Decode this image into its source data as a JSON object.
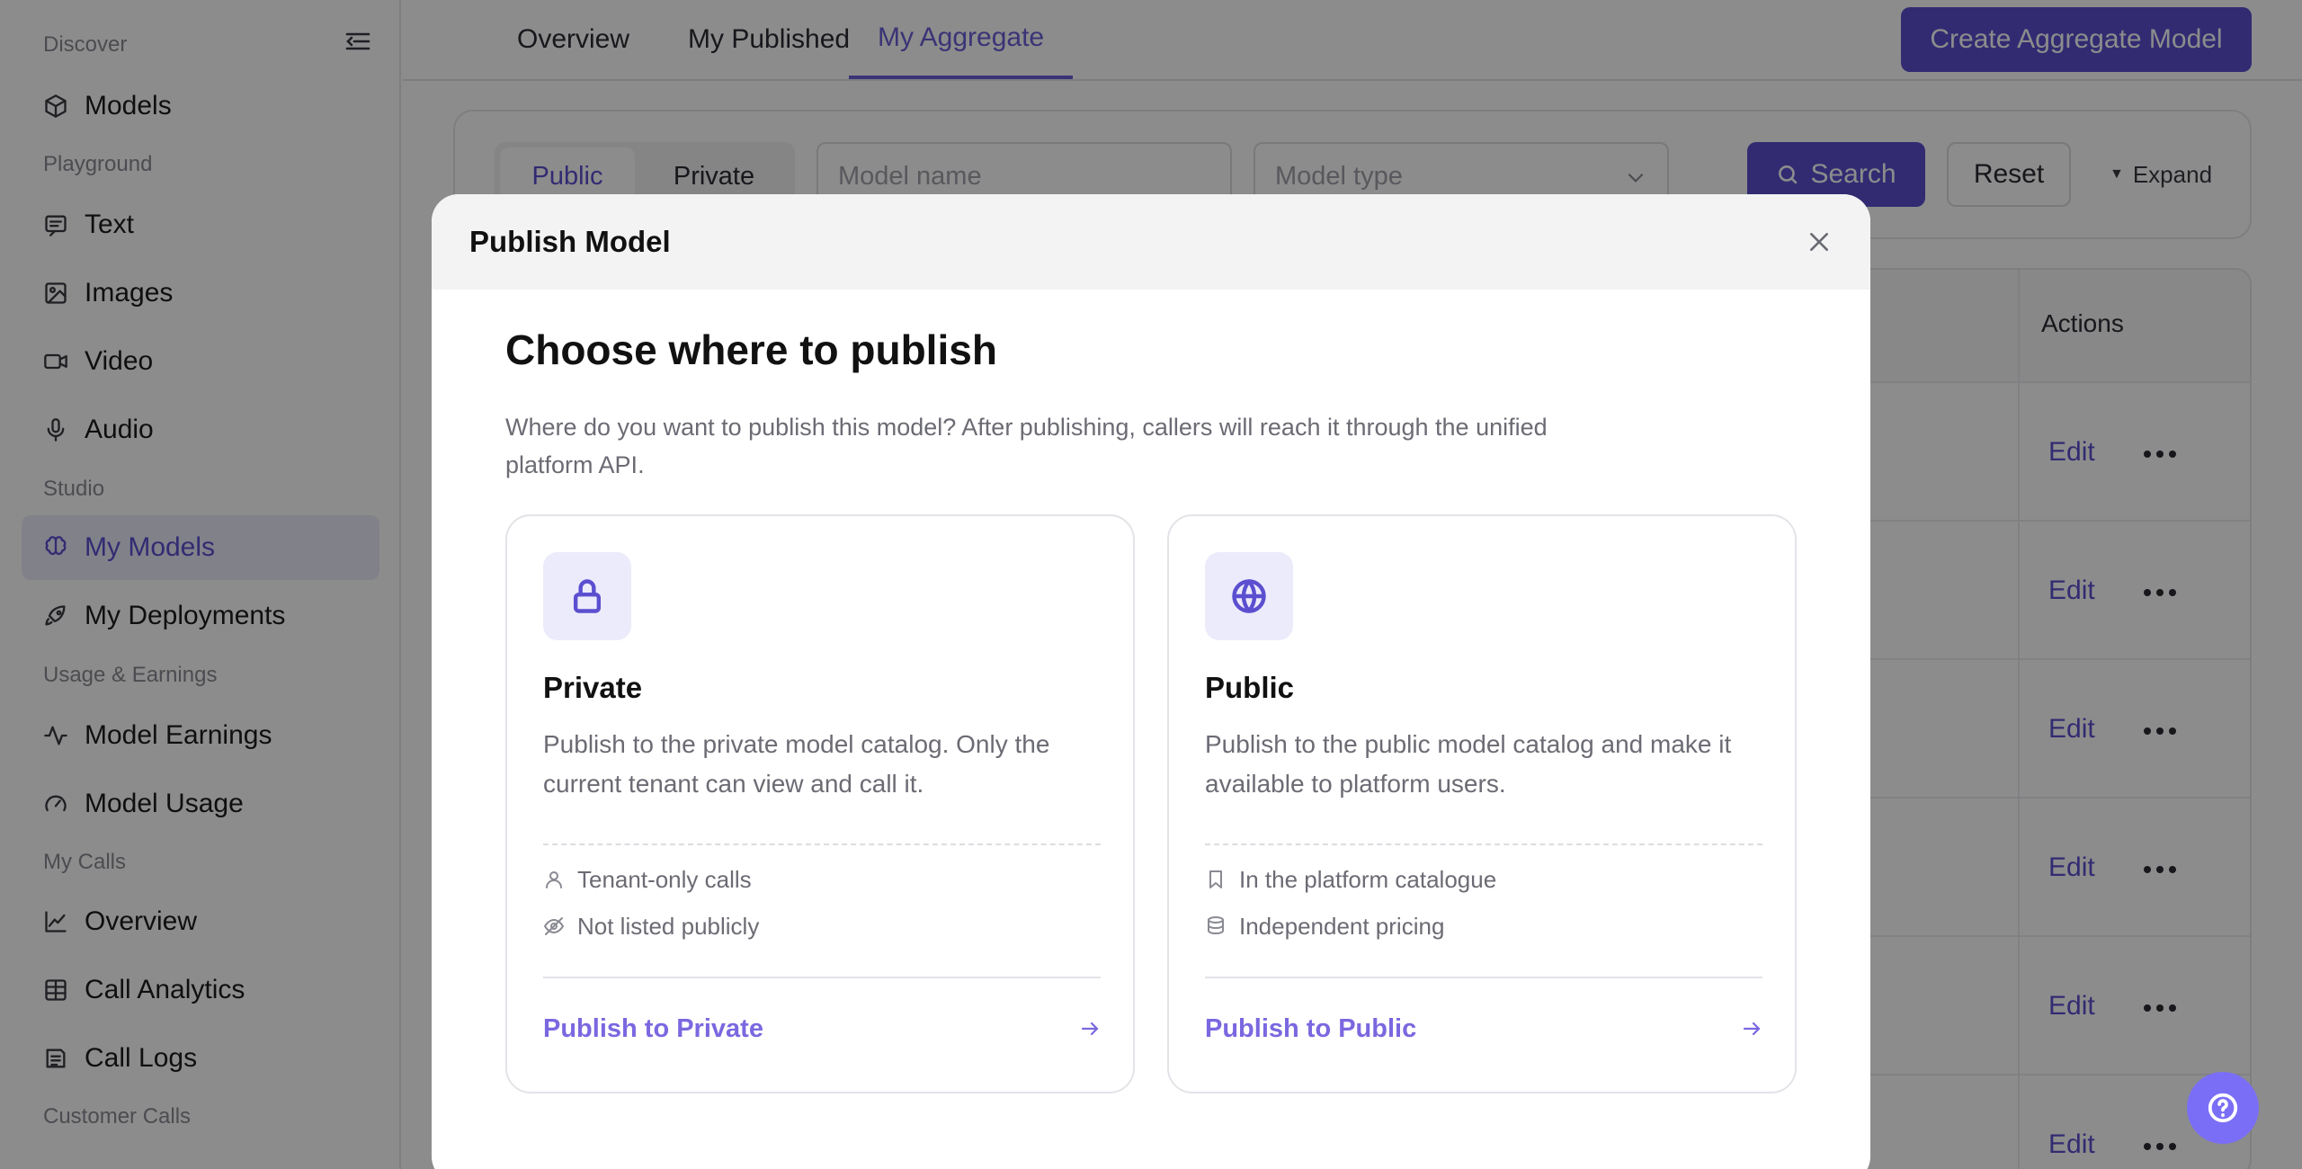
{
  "sidebar": {
    "sections": {
      "discover": "Discover",
      "playground": "Playground",
      "studio": "Studio",
      "usage": "Usage & Earnings",
      "calls": "My Calls",
      "customer": "Customer Calls"
    },
    "items": [
      {
        "label": "Models",
        "icon": "cube-icon"
      },
      {
        "label": "Text",
        "icon": "message-icon"
      },
      {
        "label": "Images",
        "icon": "image-icon"
      },
      {
        "label": "Video",
        "icon": "video-icon"
      },
      {
        "label": "Audio",
        "icon": "microphone-icon"
      },
      {
        "label": "My Models",
        "icon": "brain-icon",
        "active": true
      },
      {
        "label": "My Deployments",
        "icon": "rocket-icon"
      },
      {
        "label": "Model Earnings",
        "icon": "activity-icon"
      },
      {
        "label": "Model Usage",
        "icon": "gauge-icon"
      },
      {
        "label": "Overview",
        "icon": "line-chart-icon"
      },
      {
        "label": "Call Analytics",
        "icon": "table-icon"
      },
      {
        "label": "Call Logs",
        "icon": "log-icon"
      }
    ]
  },
  "topbar": {
    "tabs": [
      {
        "label": "Overview"
      },
      {
        "label": "My Published"
      },
      {
        "label": "My Aggregate",
        "active": true
      }
    ],
    "create_button": "Create Aggregate Model"
  },
  "filters": {
    "visibility_public": "Public",
    "visibility_private": "Private",
    "model_name_placeholder": "Model name",
    "model_type_placeholder": "Model type",
    "search": "Search",
    "reset": "Reset",
    "expand": "Expand"
  },
  "table": {
    "actions_header": "Actions",
    "edit_label": "Edit"
  },
  "modal": {
    "title": "Publish Model",
    "heading": "Choose where to publish",
    "description": "Where do you want to publish this model? After publishing, callers will reach it through the unified platform API.",
    "options": {
      "private": {
        "title": "Private",
        "description": "Publish to the private model catalog. Only the current tenant can view and call it.",
        "features": [
          "Tenant-only calls",
          "Not listed publicly"
        ],
        "action": "Publish to Private"
      },
      "public": {
        "title": "Public",
        "description": "Publish to the public model catalog and make it available to platform users.",
        "features": [
          "In the platform catalogue",
          "Independent pricing"
        ],
        "action": "Publish to Public"
      }
    }
  },
  "colors": {
    "accent": "#5b4fd0",
    "accent_light": "#ecebfb",
    "link": "#7a68e0",
    "fab": "#7b6ef6"
  }
}
